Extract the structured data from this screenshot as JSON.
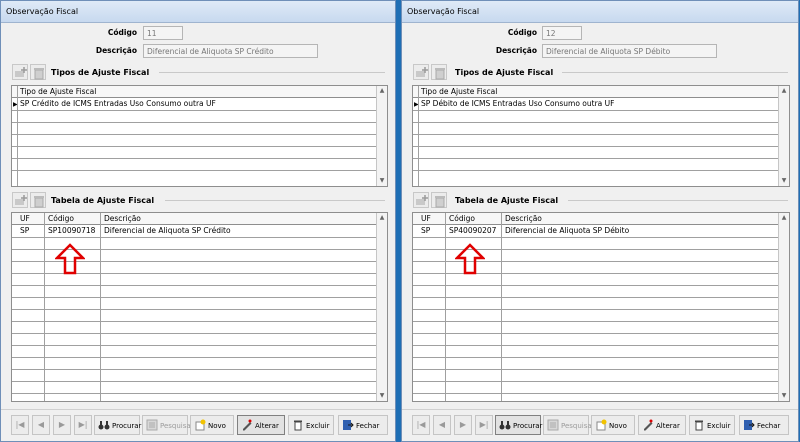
{
  "windows": [
    {
      "title": "Observação Fiscal",
      "codigo_label": "Código",
      "codigo_value": "11",
      "descricao_label": "Descrição",
      "descricao_value": "Diferencial de Aliquota SP Crédito",
      "tipos_section_title": "Tipos de Ajuste Fiscal",
      "tipos_header": "Tipo de Ajuste Fiscal",
      "tipos_row": "SP Crédito de ICMS Entradas Uso Consumo outra UF",
      "tabela_section_title": "Tabela de Ajuste Fiscal",
      "tabela_headers": [
        "UF",
        "Código",
        "Descrição"
      ],
      "tabela_row": [
        "SP",
        "SP10090718",
        "Diferencial de Aliquota SP Crédito"
      ]
    },
    {
      "title": "Observação Fiscal",
      "codigo_label": "Código",
      "codigo_value": "12",
      "descricao_label": "Descrição",
      "descricao_value": "Diferencial de Aliquota SP Débito",
      "tipos_section_title": "Tipos de Ajuste Fiscal",
      "tipos_header": "Tipo de Ajuste Fiscal",
      "tipos_row": "SP Débito de ICMS Entradas Uso Consumo outra UF",
      "tabela_section_title": "Tabela de Ajuste Fiscal",
      "tabela_headers": [
        "UF",
        "Código",
        "Descrição"
      ],
      "tabela_row": [
        "SP",
        "SP40090207",
        "Diferencial de Aliquota SP Débito"
      ]
    }
  ],
  "toolbar": {
    "procurar": "Procurar",
    "pesquisa": "Pesquisa",
    "novo": "Novo",
    "alterar": "Alterar",
    "excluir": "Excluir",
    "fechar": "Fechar"
  },
  "colors": {
    "highlight_arrow": "#e00000",
    "desktop": "#1f6fb5"
  },
  "icons": {
    "first": "first-record-icon",
    "prev": "prev-record-icon",
    "next": "next-record-icon",
    "last": "last-record-icon",
    "procurar": "binoculars-icon",
    "pesquisa": "search-list-icon",
    "novo": "new-document-icon",
    "alterar": "edit-pencil-icon",
    "excluir": "trash-icon",
    "fechar": "exit-door-icon"
  }
}
